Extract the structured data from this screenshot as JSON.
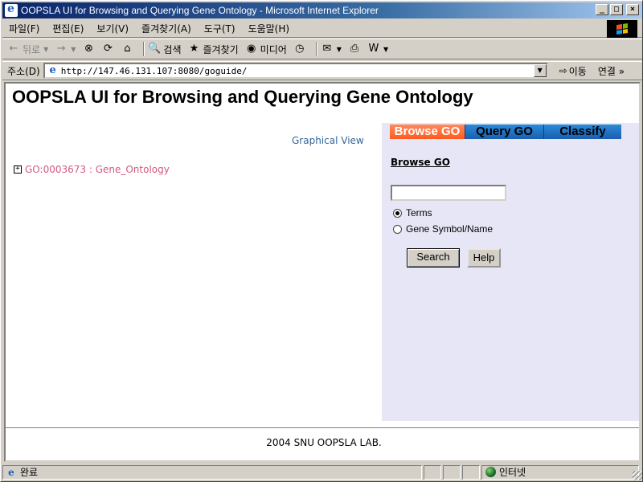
{
  "window": {
    "title": "OOPSLA UI for Browsing and Querying Gene Ontology - Microsoft Internet Explorer",
    "minimize": "_",
    "maximize": "□",
    "close": "×"
  },
  "menu": [
    "파일(F)",
    "편집(E)",
    "보기(V)",
    "즐겨찾기(A)",
    "도구(T)",
    "도움말(H)"
  ],
  "toolbar": {
    "back": "뒤로",
    "search": "검색",
    "favorites": "즐겨찾기",
    "media": "미디어"
  },
  "address": {
    "label": "주소(D)",
    "url": "http://147.46.131.107:8080/goguide/",
    "go": "이동",
    "links": "연결 »"
  },
  "page": {
    "title": "OOPSLA UI for Browsing and Querying Gene Ontology",
    "graphical_view": "Graphical View",
    "tree_expander": "+",
    "tree_root": "GO:0003673 : Gene_Ontology",
    "tabs": [
      "Browse GO",
      "Query GO",
      "Classify"
    ],
    "section_heading": "Browse GO",
    "search_value": "",
    "radio_terms": "Terms",
    "radio_gene": "Gene Symbol/Name",
    "search_button": "Search",
    "help_button": "Help",
    "footer": "2004 SNU OOPSLA LAB."
  },
  "status": {
    "text": "완료",
    "zone": "인터넷"
  },
  "colors": {
    "tab_active": "#ff6a30",
    "tab_bar": "#2a7bd0",
    "panel_bg": "#e7e6f6",
    "tree_link": "#d45a7d",
    "graphical_link": "#336699"
  }
}
